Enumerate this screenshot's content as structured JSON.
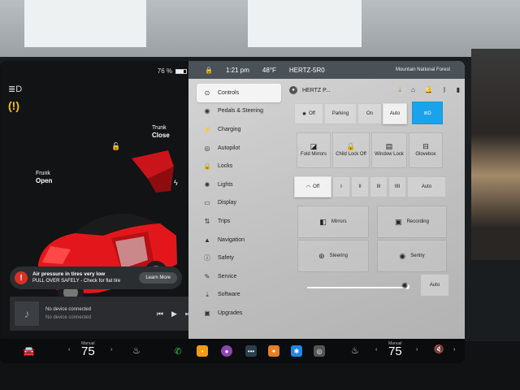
{
  "status": {
    "time": "1:21 pm",
    "temperature": "48°F",
    "network": "HERTZ-5R0",
    "battery_percent": "76 %",
    "battery_level": 0.76,
    "place": "Mountain National Forest"
  },
  "car": {
    "trunk_label": "Trunk",
    "trunk_state": "Close",
    "frunk_label": "Frunk",
    "frunk_state": "Open",
    "body_color": "#e3171b"
  },
  "alert": {
    "title": "Air pressure in tires very low",
    "message": "PULL OVER SAFELY - Check for flat tire",
    "button": "Learn More"
  },
  "media": {
    "title": "No device connected",
    "subtitle": "No device connected"
  },
  "menu": [
    {
      "label": "Controls",
      "icon": "toggle-icon",
      "glyph": "⊙"
    },
    {
      "label": "Pedals & Steering",
      "icon": "car-icon",
      "glyph": "◉"
    },
    {
      "label": "Charging",
      "icon": "bolt-icon",
      "glyph": "⚡"
    },
    {
      "label": "Autopilot",
      "icon": "steering-icon",
      "glyph": "◎"
    },
    {
      "label": "Locks",
      "icon": "lock-icon",
      "glyph": "🔒"
    },
    {
      "label": "Lights",
      "icon": "light-icon",
      "glyph": "✺"
    },
    {
      "label": "Display",
      "icon": "display-icon",
      "glyph": "▭"
    },
    {
      "label": "Trips",
      "icon": "trips-icon",
      "glyph": "⇅"
    },
    {
      "label": "Navigation",
      "icon": "navigation-icon",
      "glyph": "▲"
    },
    {
      "label": "Safety",
      "icon": "safety-icon",
      "glyph": "ⓘ"
    },
    {
      "label": "Service",
      "icon": "wrench-icon",
      "glyph": "✎"
    },
    {
      "label": "Software",
      "icon": "download-icon",
      "glyph": "⤓"
    },
    {
      "label": "Upgrades",
      "icon": "bag-icon",
      "glyph": "▣"
    }
  ],
  "user": {
    "name": "HERTZ P..."
  },
  "lights_row": {
    "off": "Off",
    "parking": "Parking",
    "on": "On",
    "auto": "Auto"
  },
  "tiles": {
    "fold_mirrors": "Fold Mirrors",
    "child_lock": "Child Lock Off",
    "window_lock": "Window Lock",
    "glovebox": "Glovebox",
    "mirrors": "Mirrors",
    "recording": "Recording",
    "steering": "Steering",
    "sentry": "Sentry",
    "brightness_auto": "Auto"
  },
  "wiper_row": {
    "off": "Off",
    "i": "I",
    "ii": "II",
    "iii": "III",
    "iiii": "IIII",
    "auto": "Auto"
  },
  "taskbar": {
    "left_temp_label": "Manual",
    "left_temp": "75",
    "right_temp_label": "Manual",
    "right_temp": "75"
  },
  "colors": {
    "accent_blue": "#1aa3ea",
    "alert_red": "#d93025",
    "warning_yellow": "#f5c400"
  }
}
